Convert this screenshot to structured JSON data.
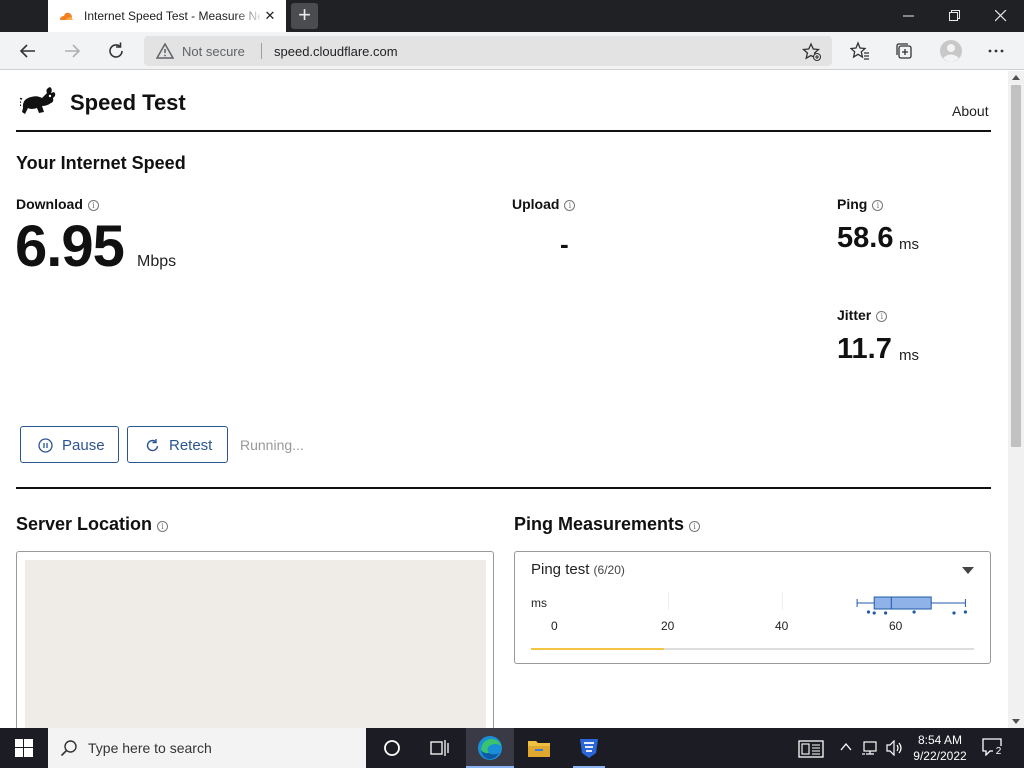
{
  "browser": {
    "tab_title": "Internet Speed Test - Measure Network Performance | Cloudflare",
    "new_tab_label": "+",
    "not_secure": "Not secure",
    "url": "speed.cloudflare.com"
  },
  "site": {
    "title": "Speed Test",
    "about_link": "About"
  },
  "speed": {
    "heading": "Your Internet Speed",
    "download": {
      "label": "Download",
      "value": "6.95",
      "unit": "Mbps"
    },
    "upload": {
      "label": "Upload",
      "value": "-"
    },
    "ping": {
      "label": "Ping",
      "value": "58.6",
      "unit": "ms"
    },
    "jitter": {
      "label": "Jitter",
      "value": "11.7",
      "unit": "ms"
    },
    "pause_label": "Pause",
    "retest_label": "Retest",
    "status": "Running..."
  },
  "server_location": {
    "heading": "Server Location"
  },
  "ping_measurements": {
    "heading": "Ping Measurements",
    "test_name": "Ping test",
    "test_count": "(6/20)",
    "axis_unit": "ms",
    "ticks": [
      "0",
      "20",
      "40",
      "60"
    ],
    "progress": 0.3,
    "box": {
      "min": 53,
      "q1": 56,
      "median": 59,
      "q3": 66,
      "max": 72
    },
    "points": [
      55,
      58,
      63,
      70,
      72,
      56
    ]
  },
  "taskbar": {
    "search_placeholder": "Type here to search",
    "time": "8:54 AM",
    "date": "9/22/2022",
    "notification_count": "2"
  },
  "colors": {
    "accent": "#2b5590",
    "progress": "#f4c542",
    "boxplot_fill": "#8fb3e8",
    "boxplot_stroke": "#1e5aa8"
  }
}
